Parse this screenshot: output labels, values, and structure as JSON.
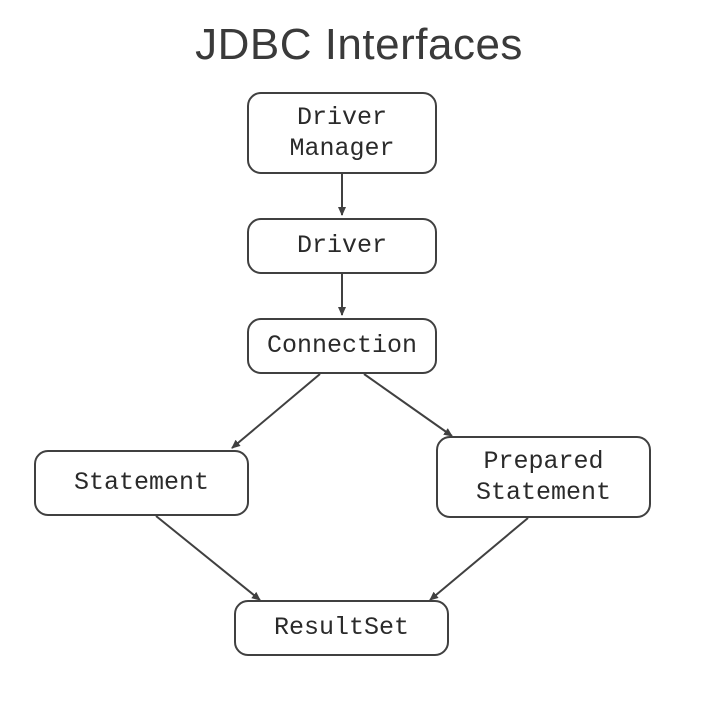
{
  "title": "JDBC Interfaces",
  "nodes": {
    "driver_manager": "Driver\nManager",
    "driver": "Driver",
    "connection": "Connection",
    "statement": "Statement",
    "prepared_statement": "Prepared\nStatement",
    "resultset": "ResultSet"
  }
}
